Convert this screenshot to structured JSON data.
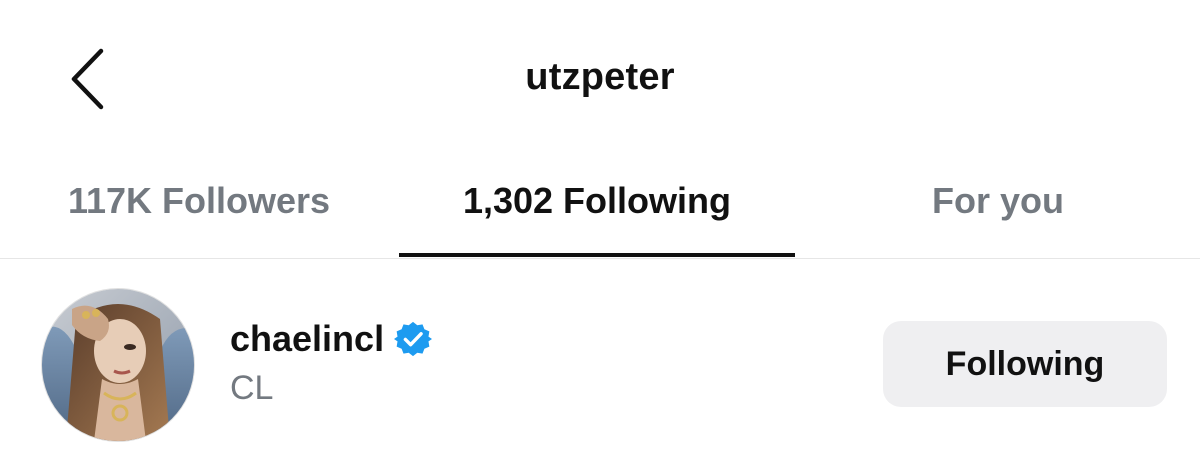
{
  "header": {
    "title": "utzpeter",
    "back_icon": "chevron-left-icon"
  },
  "tabs": [
    {
      "label": "117K Followers",
      "active": false
    },
    {
      "label": "1,302 Following",
      "active": true
    },
    {
      "label": "For you",
      "active": false
    }
  ],
  "list": {
    "items": [
      {
        "username": "chaelincl",
        "verified": true,
        "verified_icon": "verified-badge-icon",
        "full_name": "CL",
        "button_label": "Following"
      }
    ]
  },
  "colors": {
    "text_primary": "#111111",
    "text_secondary": "#737980",
    "button_bg": "#efeff1",
    "verified_blue": "#1d9bf0",
    "divider": "#e6e6e6"
  }
}
